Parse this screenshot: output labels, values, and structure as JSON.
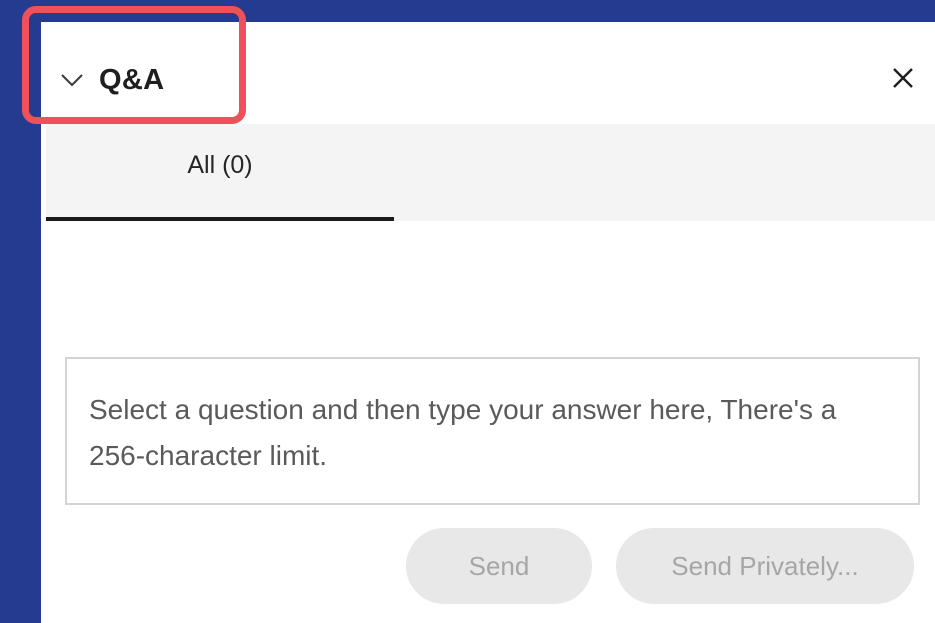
{
  "panel": {
    "title": "Q&A",
    "collapse_icon": "chevron-down-icon",
    "close_icon": "close-icon"
  },
  "tabs": [
    {
      "label": "All (0)",
      "selected": true
    }
  ],
  "answer_input": {
    "placeholder": "Select a question and then type your answer here, There's a 256-character limit.",
    "value": ""
  },
  "actions": {
    "send_label": "Send",
    "send_privately_label": "Send Privately...",
    "enabled": false
  },
  "colors": {
    "background": "#243b8f",
    "highlight": "#f0505a",
    "panel": "#ffffff",
    "tabbar": "#f4f4f4",
    "disabled_button": "#e8e8e8",
    "disabled_text": "#a6a6a6"
  }
}
